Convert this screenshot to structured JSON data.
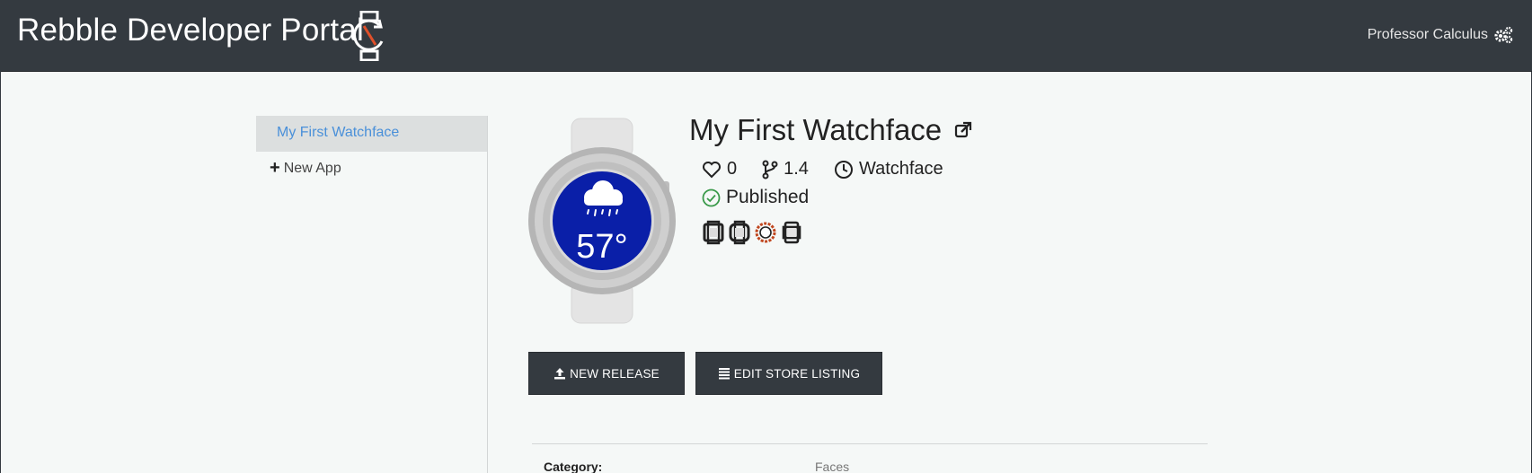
{
  "header": {
    "title": "Rebble Developer Portal",
    "user_name": "Professor Calculus",
    "logo_icon": "watch-sync-icon",
    "settings_icon": "gears-icon"
  },
  "sidebar": {
    "items": [
      {
        "label": "My First Watchface",
        "active": true
      },
      {
        "label": "New App",
        "icon": "plus-icon",
        "active": false
      }
    ]
  },
  "app": {
    "name": "My First Watchface",
    "hearts": "0",
    "version": "1.4",
    "type": "Watchface",
    "status": "Published",
    "watch_preview": {
      "temperature": "57°",
      "weather_icon": "rain-cloud-icon",
      "face_color": "#0a1fa8"
    },
    "platforms": [
      "aplite",
      "basalt",
      "chalk",
      "diorite"
    ]
  },
  "actions": {
    "new_release": "NEW RELEASE",
    "edit_listing": "EDIT STORE LISTING"
  },
  "details": {
    "category_label": "Category:",
    "category_value": "Faces"
  },
  "colors": {
    "topbar": "#343a40",
    "accent_link": "#4a90d9",
    "published": "#3a9a4a",
    "chalk_platform": "#c0461e"
  }
}
